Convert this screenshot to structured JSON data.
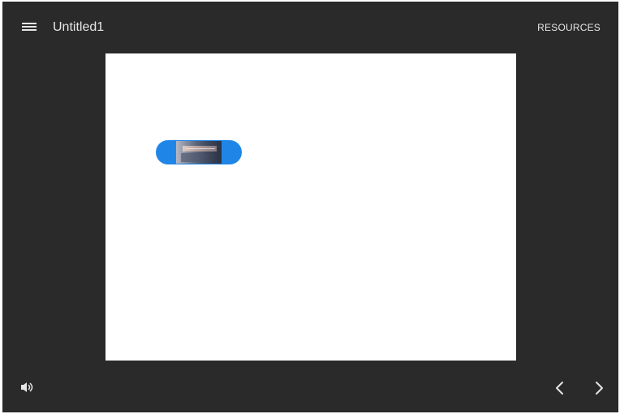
{
  "header": {
    "title": "Untitled1",
    "resources_label": "RESOURCES",
    "menu_icon": "hamburger-menu-icon"
  },
  "slide": {
    "background": "#ffffff",
    "media": {
      "icon": "video-thumbnail",
      "accent": "#1f86e8"
    }
  },
  "footer": {
    "speaker_icon": "speaker-icon",
    "prev_icon": "chevron-left-icon",
    "next_icon": "chevron-right-icon"
  },
  "colors": {
    "app_background": "#2a2a2a",
    "foreground": "#e6e6e6"
  }
}
